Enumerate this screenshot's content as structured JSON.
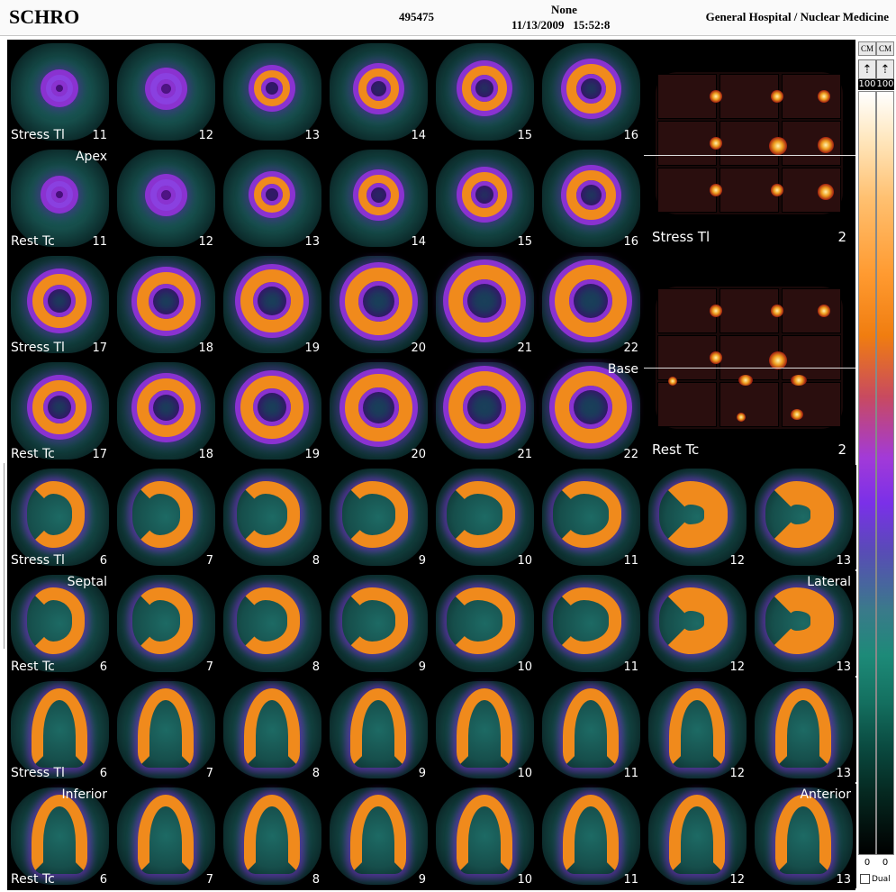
{
  "header": {
    "patient": "SCHRO",
    "id": "495475",
    "none_label": "None",
    "datetime": "11/13/2009   15:52:8",
    "hospital": "General Hospital / Nuclear Medicine"
  },
  "orient": {
    "apex": "Apex",
    "base": "Base",
    "septal": "Septal",
    "lateral": "Lateral",
    "inferior": "Inferior",
    "anterior": "Anterior"
  },
  "rows": [
    {
      "label": "Stress Tl",
      "nums": [
        "11",
        "12",
        "13",
        "14",
        "15",
        "16"
      ]
    },
    {
      "label": "Rest Tc",
      "nums": [
        "11",
        "12",
        "13",
        "14",
        "15",
        "16"
      ]
    },
    {
      "label": "Stress Tl",
      "nums": [
        "17",
        "18",
        "19",
        "20",
        "21",
        "22"
      ]
    },
    {
      "label": "Rest Tc",
      "nums": [
        "17",
        "18",
        "19",
        "20",
        "21",
        "22"
      ]
    },
    {
      "label": "Stress Tl",
      "nums": [
        "6",
        "7",
        "8",
        "9",
        "10",
        "11",
        "12",
        "13"
      ]
    },
    {
      "label": "Rest Tc",
      "nums": [
        "6",
        "7",
        "8",
        "9",
        "10",
        "11",
        "12",
        "13"
      ]
    },
    {
      "label": "Stress Tl",
      "nums": [
        "6",
        "7",
        "8",
        "9",
        "10",
        "11",
        "12",
        "13"
      ]
    },
    {
      "label": "Rest Tc",
      "nums": [
        "6",
        "7",
        "8",
        "9",
        "10",
        "11",
        "12",
        "13"
      ]
    }
  ],
  "reference": [
    {
      "label": "Stress Tl",
      "num": "2"
    },
    {
      "label": "Rest Tc",
      "num": "2"
    }
  ],
  "colorbar": {
    "cm": "CM",
    "top_value": "100",
    "bottom_value": "0",
    "dual_label": "Dual"
  }
}
